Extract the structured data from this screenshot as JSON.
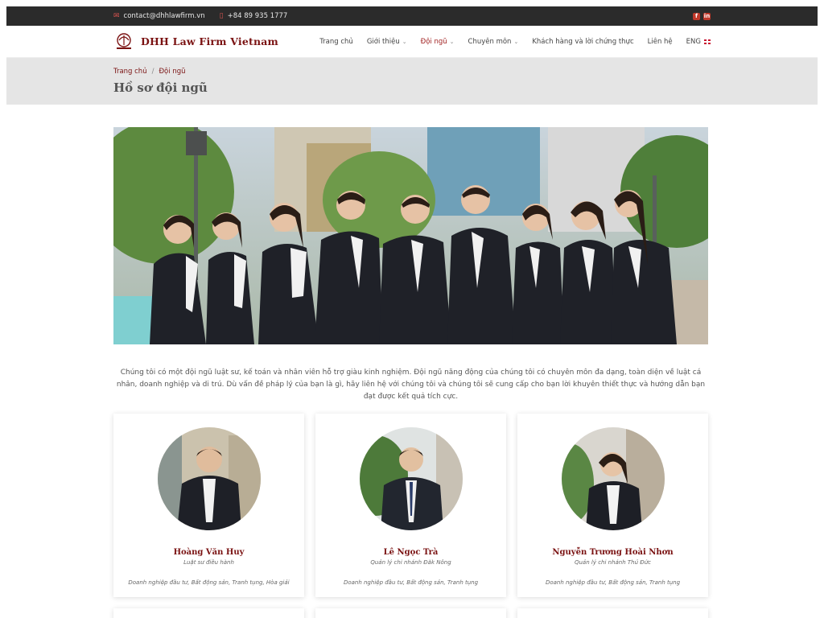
{
  "topbar": {
    "email": "contact@dhhlawfirm.vn",
    "phone": "+84 89 935 1777",
    "email_icon": "envelope-icon",
    "phone_icon": "phone-icon",
    "social": [
      "facebook-icon",
      "linkedin-icon"
    ]
  },
  "header": {
    "logo_text": "DHH Law Firm Vietnam",
    "nav": [
      {
        "label": "Trang chủ",
        "dropdown": false,
        "active": false
      },
      {
        "label": "Giới thiệu",
        "dropdown": true,
        "active": false
      },
      {
        "label": "Đội ngũ",
        "dropdown": true,
        "active": true
      },
      {
        "label": "Chuyên môn",
        "dropdown": true,
        "active": false
      },
      {
        "label": "Khách hàng và lời chứng thực",
        "dropdown": false,
        "active": false
      },
      {
        "label": "Liên hệ",
        "dropdown": false,
        "active": false
      },
      {
        "label": "ENG",
        "dropdown": false,
        "active": false
      }
    ]
  },
  "breadcrumb": {
    "home": "Trang chủ",
    "separator": "/",
    "current": "Đội ngũ"
  },
  "page_title": "Hồ sơ đội ngũ",
  "intro": "Chúng tôi có một đội ngũ luật sư, kế toán và nhân viên hỗ trợ giàu kinh nghiệm. Đội ngũ năng động của chúng tôi có chuyên môn đa dạng, toàn diện về luật cá nhân, doanh nghiệp và di trú. Dù vấn đề pháp lý của bạn là gì, hãy liên hệ với chúng tôi và chúng tôi sẽ cung cấp cho bạn lời khuyên thiết thực và hướng dẫn bạn đạt được kết quả tích cực.",
  "team": [
    {
      "name": "Hoàng Văn Huy",
      "role": "Luật sư điều hành",
      "specialties": "Doanh nghiệp đầu tư, Bất động sản, Tranh tụng, Hòa giải"
    },
    {
      "name": "Lê Ngọc Trà",
      "role": "Quản lý chi nhánh Đăk Nông",
      "specialties": "Doanh nghiệp đầu tư, Bất động sản, Tranh tụng"
    },
    {
      "name": "Nguyễn Trương Hoài Nhơn",
      "role": "Quản lý chi nhánh Thủ Đức",
      "specialties": "Doanh nghiệp đầu tư, Bất động sản, Tranh tụng"
    }
  ],
  "colors": {
    "brand": "#7a1212",
    "topbar_bg": "#2b2b2b",
    "band_bg": "#e5e5e5"
  }
}
